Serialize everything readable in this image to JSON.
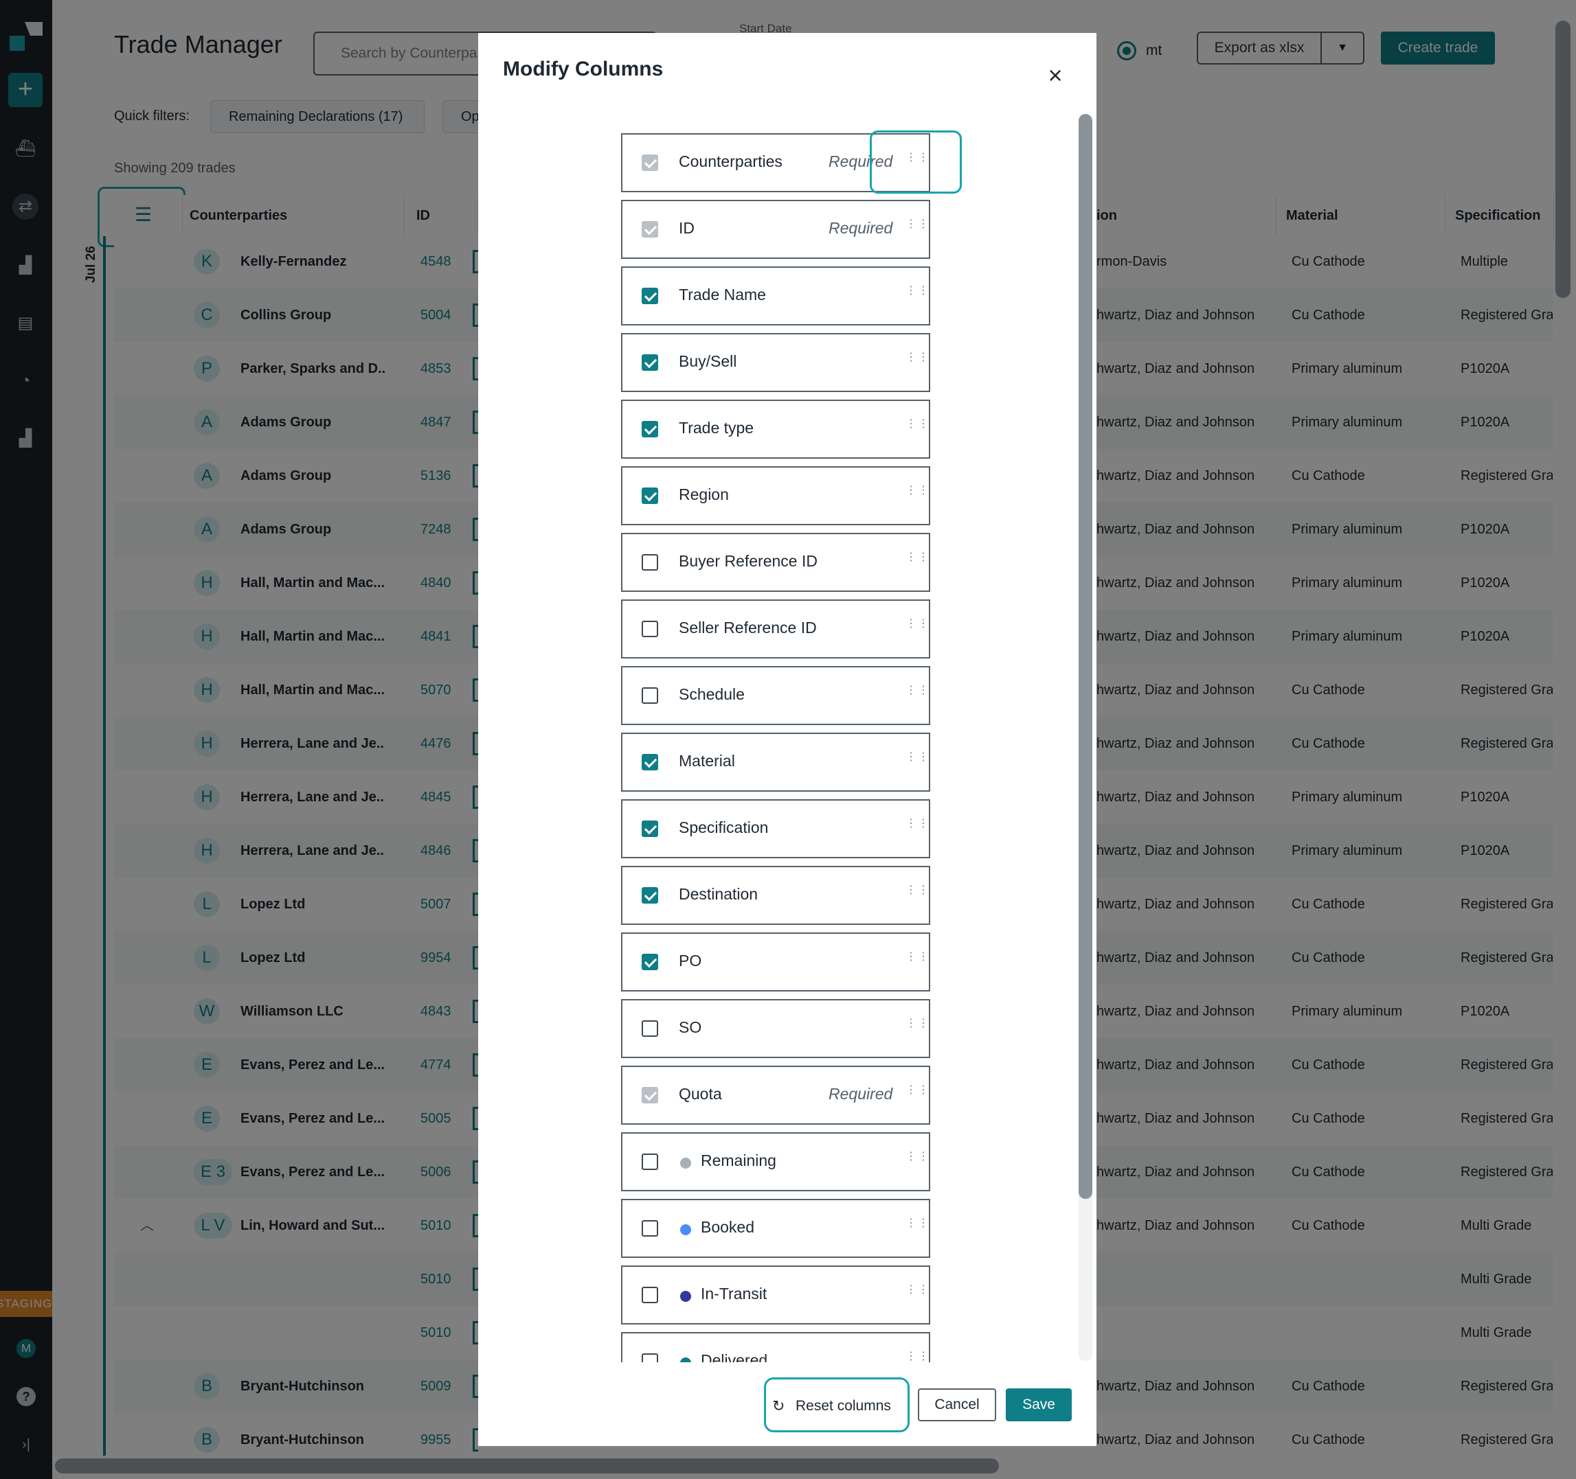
{
  "app": {
    "title": "Trade Manager",
    "search_placeholder": "Search by Counterparty",
    "start_date_label": "Start Date",
    "unit": "mt",
    "export_label": "Export as xlsx",
    "create_label": "Create trade",
    "quick_filters_label": "Quick filters:",
    "quick_filters": [
      "Remaining Declarations (17)",
      "Op"
    ],
    "showing": "Showing 209 trades",
    "date_marker": "Jul 26",
    "env_badge": "STAGING",
    "user_initial": "M"
  },
  "table": {
    "headers": {
      "counterparties": "Counterparties",
      "id": "ID",
      "location": "ion",
      "material": "Material",
      "specification": "Specification"
    },
    "rows": [
      {
        "initial": "K",
        "counterparty": "Kelly-Fernandez",
        "id": "4548",
        "location": "rmon-Davis",
        "material": "Cu Cathode",
        "spec": "Multiple"
      },
      {
        "initial": "C",
        "counterparty": "Collins Group",
        "id": "5004",
        "location": "hwartz, Diaz and Johnson",
        "material": "Cu Cathode",
        "spec": "Registered Gra"
      },
      {
        "initial": "P",
        "counterparty": "Parker, Sparks and D...",
        "id": "4853",
        "location": "hwartz, Diaz and Johnson",
        "material": "Primary aluminum",
        "spec": "P1020A"
      },
      {
        "initial": "A",
        "counterparty": "Adams Group",
        "id": "4847",
        "location": "hwartz, Diaz and Johnson",
        "material": "Primary aluminum",
        "spec": "P1020A"
      },
      {
        "initial": "A",
        "counterparty": "Adams Group",
        "id": "5136",
        "location": "hwartz, Diaz and Johnson",
        "material": "Cu Cathode",
        "spec": "Registered Gra"
      },
      {
        "initial": "A",
        "counterparty": "Adams Group",
        "id": "7248",
        "location": "hwartz, Diaz and Johnson",
        "material": "Primary aluminum",
        "spec": "P1020A"
      },
      {
        "initial": "H",
        "counterparty": "Hall, Martin and Mac...",
        "id": "4840",
        "location": "hwartz, Diaz and Johnson",
        "material": "Primary aluminum",
        "spec": "P1020A"
      },
      {
        "initial": "H",
        "counterparty": "Hall, Martin and Mac...",
        "id": "4841",
        "location": "hwartz, Diaz and Johnson",
        "material": "Primary aluminum",
        "spec": "P1020A"
      },
      {
        "initial": "H",
        "counterparty": "Hall, Martin and Mac...",
        "id": "5070",
        "location": "hwartz, Diaz and Johnson",
        "material": "Cu Cathode",
        "spec": "Registered Gra"
      },
      {
        "initial": "H",
        "counterparty": "Herrera, Lane and Je...",
        "id": "4476",
        "location": "hwartz, Diaz and Johnson",
        "material": "Cu Cathode",
        "spec": "Registered Gra"
      },
      {
        "initial": "H",
        "counterparty": "Herrera, Lane and Je...",
        "id": "4845",
        "location": "hwartz, Diaz and Johnson",
        "material": "Primary aluminum",
        "spec": "P1020A"
      },
      {
        "initial": "H",
        "counterparty": "Herrera, Lane and Je...",
        "id": "4846",
        "location": "hwartz, Diaz and Johnson",
        "material": "Primary aluminum",
        "spec": "P1020A"
      },
      {
        "initial": "L",
        "counterparty": "Lopez Ltd",
        "id": "5007",
        "location": "hwartz, Diaz and Johnson",
        "material": "Cu Cathode",
        "spec": "Registered Gra"
      },
      {
        "initial": "L",
        "counterparty": "Lopez Ltd",
        "id": "9954",
        "location": "hwartz, Diaz and Johnson",
        "material": "Cu Cathode",
        "spec": "Registered Gra"
      },
      {
        "initial": "W",
        "counterparty": "Williamson LLC",
        "id": "4843",
        "location": "hwartz, Diaz and Johnson",
        "material": "Primary aluminum",
        "spec": "P1020A"
      },
      {
        "initial": "E",
        "counterparty": "Evans, Perez and Le...",
        "id": "4774",
        "location": "hwartz, Diaz and Johnson",
        "material": "Cu Cathode",
        "spec": "Registered Gra"
      },
      {
        "initial": "E",
        "counterparty": "Evans, Perez and Le...",
        "id": "5005",
        "location": "hwartz, Diaz and Johnson",
        "material": "Cu Cathode",
        "spec": "Registered Gra"
      },
      {
        "initial": "E 3",
        "counterparty": "Evans, Perez and Le...",
        "id": "5006",
        "location": "hwartz, Diaz and Johnson",
        "material": "Cu Cathode",
        "spec": "Registered Gra"
      },
      {
        "initial": "L V",
        "counterparty": "Lin, Howard and Sut...",
        "id": "5010",
        "location": "hwartz, Diaz and Johnson",
        "material": "Cu Cathode",
        "spec": "Multi Grade",
        "expanded": true
      },
      {
        "initial": "",
        "counterparty": "",
        "id": "5010",
        "location": "",
        "material": "",
        "spec": "Multi Grade"
      },
      {
        "initial": "",
        "counterparty": "",
        "id": "5010",
        "location": "",
        "material": "",
        "spec": "Multi Grade"
      },
      {
        "initial": "B",
        "counterparty": "Bryant-Hutchinson",
        "id": "5009",
        "location": "hwartz, Diaz and Johnson",
        "material": "Cu Cathode",
        "spec": "Registered Gra"
      },
      {
        "initial": "B",
        "counterparty": "Bryant-Hutchinson",
        "id": "9955",
        "location": "hwartz, Diaz and Johnson",
        "material": "Cu Cathode",
        "spec": "Registered Gra"
      }
    ]
  },
  "modal": {
    "title": "Modify Columns",
    "required_label": "Required",
    "columns": [
      {
        "label": "Counterparties",
        "state": "required"
      },
      {
        "label": "ID",
        "state": "required"
      },
      {
        "label": "Trade Name",
        "state": "checked"
      },
      {
        "label": "Buy/Sell",
        "state": "checked"
      },
      {
        "label": "Trade type",
        "state": "checked"
      },
      {
        "label": "Region",
        "state": "checked"
      },
      {
        "label": "Buyer Reference ID",
        "state": "unchecked"
      },
      {
        "label": "Seller Reference ID",
        "state": "unchecked"
      },
      {
        "label": "Schedule",
        "state": "unchecked"
      },
      {
        "label": "Material",
        "state": "checked"
      },
      {
        "label": "Specification",
        "state": "checked"
      },
      {
        "label": "Destination",
        "state": "checked"
      },
      {
        "label": "PO",
        "state": "checked"
      },
      {
        "label": "SO",
        "state": "unchecked"
      },
      {
        "label": "Quota",
        "state": "required"
      },
      {
        "label": "Remaining",
        "state": "unchecked",
        "dot_color": "#a7b0b7"
      },
      {
        "label": "Booked",
        "state": "unchecked",
        "dot_color": "#4a8ef0"
      },
      {
        "label": "In-Transit",
        "state": "unchecked",
        "dot_color": "#2e3a9e"
      },
      {
        "label": "Delivered",
        "state": "unchecked",
        "dot_color": "#0f7e86"
      }
    ],
    "reset_label": "Reset columns",
    "cancel_label": "Cancel",
    "save_label": "Save"
  },
  "colors": {
    "accent": "#0f7e86",
    "highlight": "#18a4ad",
    "sidebar": "#1c2329"
  }
}
